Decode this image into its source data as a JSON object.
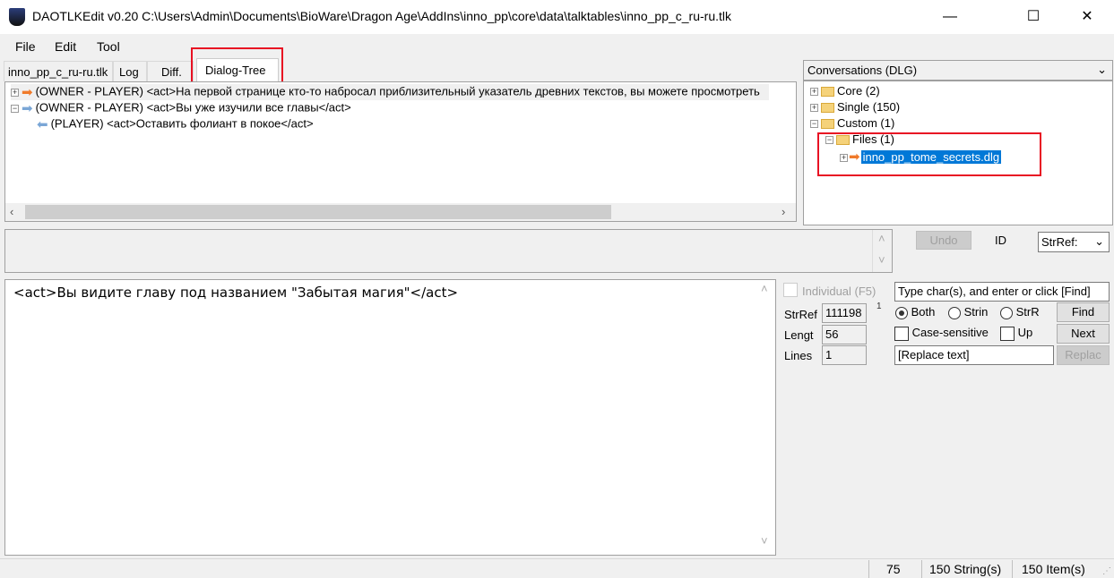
{
  "window": {
    "title": "DAOTLKEdit v0.20 C:\\Users\\Admin\\Documents\\BioWare\\Dragon Age\\AddIns\\inno_pp\\core\\data\\talktables\\inno_pp_c_ru-ru.tlk",
    "minimize": "—",
    "maximize": "☐",
    "close": "✕"
  },
  "menu": [
    "File",
    "Edit",
    "Tool"
  ],
  "tabs": [
    "inno_pp_c_ru-ru.tlk",
    "Log",
    "Diff.",
    "Dialog-Tree"
  ],
  "dialog_tree": [
    {
      "text": "(OWNER - PLAYER) <act>На первой странице кто-то набросал приблизительный указатель древних текстов, вы можете просмотреть",
      "expander": "+",
      "arrow": "➡"
    },
    {
      "text": "(OWNER - PLAYER) <act>Вы уже изучили все главы</act>",
      "expander": "−",
      "arrow": "➡"
    },
    {
      "text": "(PLAYER) <act>Оставить фолиант в покое</act>",
      "arrow": "⬅"
    }
  ],
  "conversations": {
    "header": "Conversations (DLG)",
    "items": [
      {
        "label": "Core (2)",
        "expander": "+"
      },
      {
        "label": "Single (150)",
        "expander": "+"
      },
      {
        "label": "Custom (1)",
        "expander": "−"
      },
      {
        "label": "Files (1)",
        "expander": "−"
      },
      {
        "label": "inno_pp_tome_secrets.dlg",
        "expander": "+"
      }
    ]
  },
  "controls": {
    "undo": "Undo",
    "id_label": "ID",
    "strref_select": "StrRef:",
    "individual": "Individual (F5)",
    "strref_label": "StrRef",
    "strref_value": "111198",
    "length_label": "Lengt",
    "length_value": "56",
    "lines_label": "Lines",
    "lines_value": "1",
    "counter": "1",
    "find_input": "Type char(s), and enter or click [Find]",
    "radio_both": "Both",
    "radio_string": "Strin",
    "radio_strref": "StrR",
    "find": "Find",
    "case_sensitive": "Case-sensitive",
    "up": "Up",
    "next": "Next",
    "replace_input": "[Replace text]",
    "replace": "Replac"
  },
  "editor": {
    "text": "<act>Вы видите главу под названием \"Забытая магия\"</act>"
  },
  "status": {
    "value": "75",
    "strings": "150 String(s)",
    "items": "150 Item(s)"
  }
}
